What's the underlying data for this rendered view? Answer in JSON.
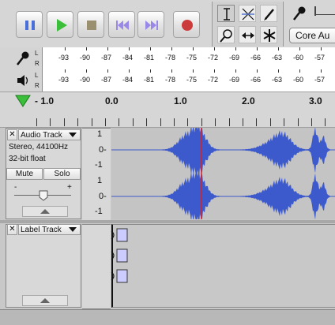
{
  "toolbar": {
    "transport": [
      {
        "name": "pause",
        "label": "Pause"
      },
      {
        "name": "play",
        "label": "Play"
      },
      {
        "name": "stop",
        "label": "Stop"
      },
      {
        "name": "skip-start",
        "label": "Skip to Start"
      },
      {
        "name": "skip-end",
        "label": "Skip to End"
      },
      {
        "name": "record",
        "label": "Record"
      }
    ],
    "device_label": "Core Au",
    "colors": {
      "pause": "#4a6fd8",
      "play": "#3bbf3b",
      "stop": "#9a9070",
      "skip": "#9a88e8",
      "record": "#cc3b3b"
    }
  },
  "meters": {
    "record_ticks": [
      "-93",
      "-90",
      "-87",
      "-84",
      "-81",
      "-78",
      "-75",
      "-72",
      "-69",
      "-66",
      "-63",
      "-60",
      "-57"
    ],
    "play_ticks": [
      "-93",
      "-90",
      "-87",
      "-84",
      "-81",
      "-78",
      "-75",
      "-72",
      "-69",
      "-66",
      "-63",
      "-60",
      "-57"
    ],
    "channel_l": "L",
    "channel_r": "R"
  },
  "ruler": {
    "labels": [
      "- 1.0",
      "0.0",
      "1.0",
      "2.0",
      "3.0"
    ]
  },
  "audio_track": {
    "name": "Audio Track",
    "info_line1": "Stereo, 44100Hz",
    "info_line2": "32-bit float",
    "mute_label": "Mute",
    "solo_label": "Solo",
    "gain_minus": "-",
    "gain_plus": "+",
    "scale": [
      "1",
      "0-",
      "-1",
      "1",
      "0-",
      "-1"
    ]
  },
  "label_track": {
    "name": "Label Track"
  },
  "colors": {
    "waveform": "#3d5acc",
    "cursor": "#e02020",
    "panel": "#d8d8d8"
  }
}
